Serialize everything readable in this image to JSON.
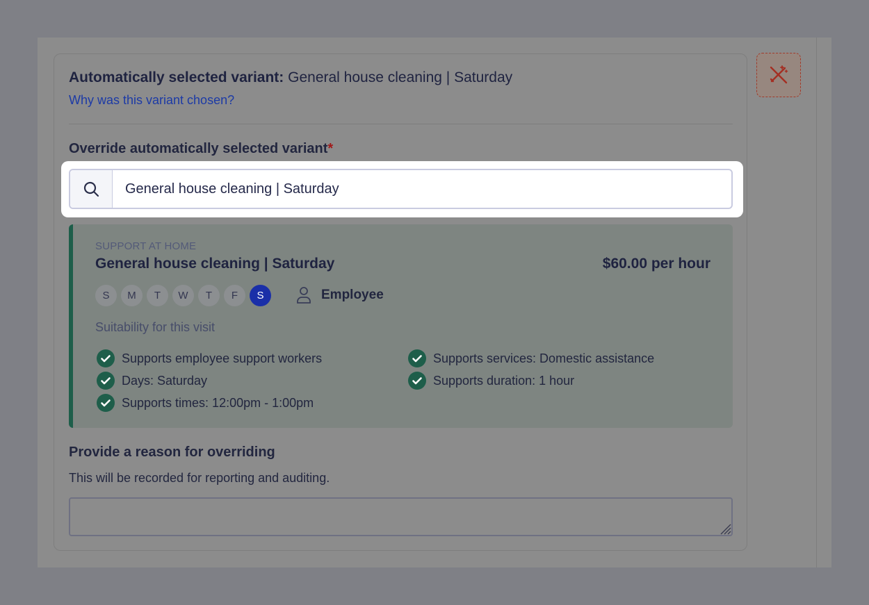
{
  "auto_selected": {
    "label": "Automatically selected variant:",
    "value": "General house cleaning | Saturday",
    "why_link": "Why was this variant chosen?"
  },
  "override": {
    "label": "Override automatically selected variant",
    "required_mark": "*",
    "search_value": "General house cleaning | Saturday"
  },
  "variant": {
    "category": "SUPPORT AT HOME",
    "name": "General house cleaning | Saturday",
    "price": "$60.00 per hour",
    "days": [
      {
        "letter": "S",
        "active": false
      },
      {
        "letter": "M",
        "active": false
      },
      {
        "letter": "T",
        "active": false
      },
      {
        "letter": "W",
        "active": false
      },
      {
        "letter": "T",
        "active": false
      },
      {
        "letter": "F",
        "active": false
      },
      {
        "letter": "S",
        "active": true
      }
    ],
    "worker_type": "Employee",
    "suitability_title": "Suitability for this visit",
    "criteria": [
      "Supports employee support workers",
      "Days: Saturday",
      "Supports times: 12:00pm - 1:00pm",
      "Supports services: Domestic assistance",
      "Supports duration: 1 hour"
    ]
  },
  "reason": {
    "title": "Provide a reason for overriding",
    "help": "This will be recorded for reporting and auditing.",
    "value": ""
  },
  "icons": {
    "search": "search-icon",
    "employee": "person-icon",
    "check": "check-circle-icon",
    "ai": "magic-wand-icon"
  },
  "colors": {
    "accent": "#1a2fa8",
    "success": "#1e5e4a",
    "link": "#1c3aa6",
    "required": "#a11818"
  }
}
